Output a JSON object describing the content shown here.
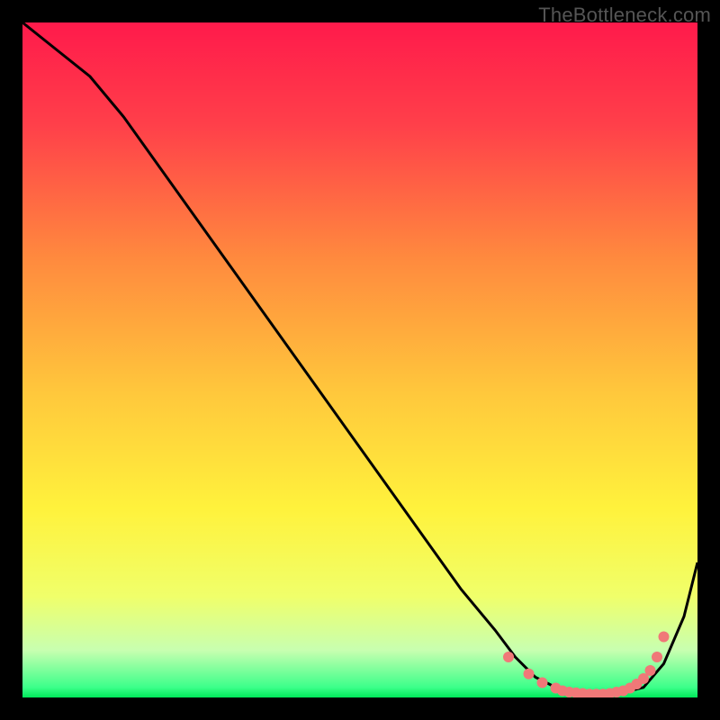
{
  "watermark": "TheBottleneck.com",
  "chart_data": {
    "type": "line",
    "title": "",
    "xlabel": "",
    "ylabel": "",
    "xlim": [
      0,
      100
    ],
    "ylim": [
      0,
      100
    ],
    "grid": false,
    "legend": false,
    "series": [
      {
        "name": "curve",
        "x": [
          0,
          5,
          10,
          15,
          20,
          25,
          30,
          35,
          40,
          45,
          50,
          55,
          60,
          65,
          70,
          73,
          76,
          80,
          84,
          88,
          92,
          95,
          98,
          100
        ],
        "y": [
          100,
          96,
          92,
          86,
          79,
          72,
          65,
          58,
          51,
          44,
          37,
          30,
          23,
          16,
          10,
          6,
          3,
          1,
          0.5,
          0.5,
          1.5,
          5,
          12,
          20
        ]
      }
    ],
    "markers": {
      "name": "bottom-dots",
      "x": [
        72,
        75,
        77,
        79,
        80,
        81,
        82,
        83,
        84,
        85,
        86,
        87,
        88,
        89,
        90,
        91,
        92,
        93,
        94,
        95
      ],
      "y": [
        6,
        3.5,
        2.2,
        1.4,
        1.0,
        0.8,
        0.7,
        0.6,
        0.5,
        0.5,
        0.5,
        0.6,
        0.8,
        1.0,
        1.4,
        2.0,
        2.8,
        4.0,
        6.0,
        9.0
      ]
    },
    "gradient_stops": [
      {
        "offset": 0.0,
        "color": "#ff1a4b"
      },
      {
        "offset": 0.15,
        "color": "#ff3f4a"
      },
      {
        "offset": 0.35,
        "color": "#ff8a3e"
      },
      {
        "offset": 0.55,
        "color": "#ffc83c"
      },
      {
        "offset": 0.72,
        "color": "#fff23c"
      },
      {
        "offset": 0.85,
        "color": "#f0ff6a"
      },
      {
        "offset": 0.93,
        "color": "#c8ffb0"
      },
      {
        "offset": 0.985,
        "color": "#3cff8a"
      },
      {
        "offset": 1.0,
        "color": "#00e85a"
      }
    ]
  }
}
